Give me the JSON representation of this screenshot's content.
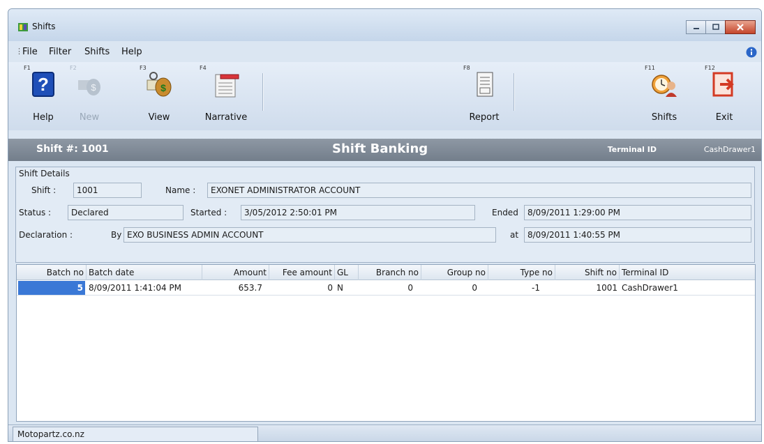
{
  "window": {
    "title": "Shifts"
  },
  "menu": [
    "File",
    "Filter",
    "Shifts",
    "Help"
  ],
  "toolbar": {
    "help": {
      "key": "F1",
      "label": "Help"
    },
    "new": {
      "key": "F2",
      "label": "New"
    },
    "view": {
      "key": "F3",
      "label": "View"
    },
    "narrative": {
      "key": "F4",
      "label": "Narrative"
    },
    "report": {
      "key": "F8",
      "label": "Report"
    },
    "shifts": {
      "key": "F11",
      "label": "Shifts"
    },
    "exit": {
      "key": "F12",
      "label": "Exit"
    }
  },
  "header": {
    "shift_label": "Shift #: 1001",
    "title": "Shift Banking",
    "terminal_label": "Terminal ID",
    "terminal_value": "CashDrawer1"
  },
  "details": {
    "group_title": "Shift Details",
    "shift_label": "Shift :",
    "shift_value": "1001",
    "name_label": "Name :",
    "name_value": "EXONET ADMINISTRATOR ACCOUNT",
    "status_label": "Status :",
    "status_value": "Declared",
    "started_label": "Started :",
    "started_value": "3/05/2012 2:50:01 PM",
    "ended_label": "Ended",
    "ended_value": "8/09/2011 1:29:00 PM",
    "declaration_label": "Declaration :",
    "by_label": "By",
    "by_value": "EXO BUSINESS ADMIN ACCOUNT",
    "at_label": "at",
    "at_value": "8/09/2011 1:40:55 PM"
  },
  "grid": {
    "columns": [
      "Batch no",
      "Batch date",
      "Amount",
      "Fee amount",
      "GL",
      "Branch no",
      "Group no",
      "Type no",
      "Shift no",
      "Terminal ID"
    ],
    "rows": [
      [
        "5",
        "8/09/2011 1:41:04 PM",
        "653.7",
        "0",
        "N",
        "0",
        "0",
        "-1",
        "1001",
        "CashDrawer1"
      ]
    ]
  },
  "status": {
    "company": "Motopartz.co.nz"
  },
  "colors": {
    "header_bar": "#7d8894",
    "selection": "#3a78d6",
    "exit_red": "#d33a24"
  },
  "icons": [
    "app-icon",
    "info-icon",
    "help-icon",
    "new-icon",
    "view-icon",
    "narrative-icon",
    "report-icon",
    "shifts-icon",
    "exit-icon",
    "minimize-icon",
    "maximize-icon",
    "close-icon"
  ]
}
